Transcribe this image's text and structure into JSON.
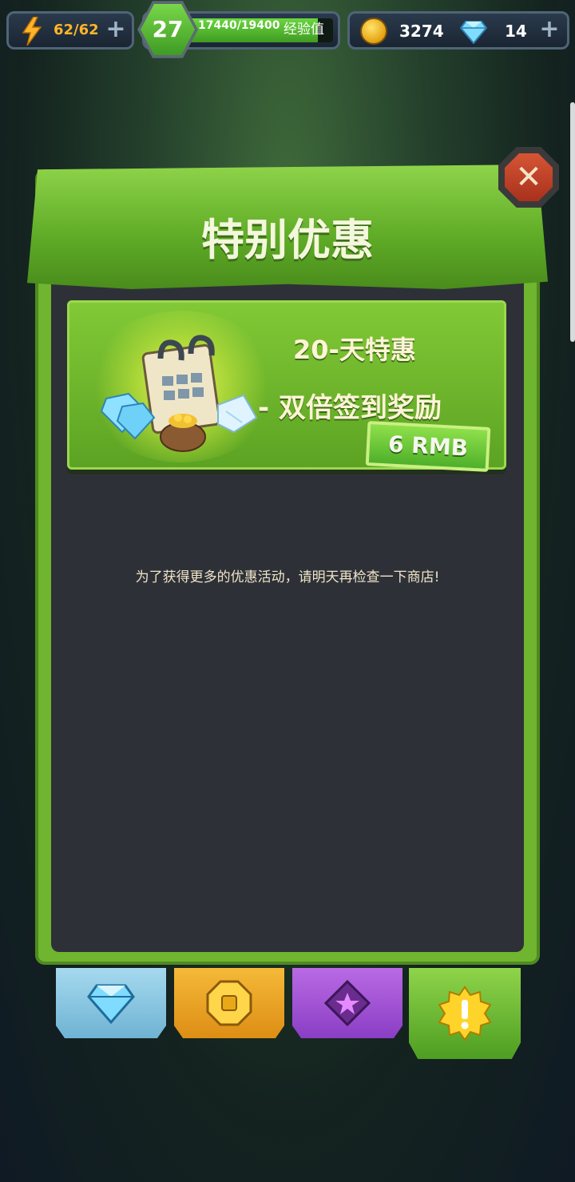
{
  "topbar": {
    "energy": "62/62",
    "level": "27",
    "xp_text": "17440/19400",
    "xp_label": "经验值",
    "xp_fraction": 0.899,
    "coins": "3274",
    "gems": "14"
  },
  "dialog": {
    "title": "特别优惠",
    "close_icon": "close-x-icon",
    "offer": {
      "title_line1": "20-天特惠",
      "title_line2": "- 双倍签到奖励",
      "price": "6 RMB"
    },
    "notice": "为了获得更多的优惠活动，请明天再检查一下商店!"
  },
  "tabs": [
    "gem-tab-icon",
    "coin-tab-icon",
    "star-tab-icon",
    "alert-tab-icon"
  ],
  "colors": {
    "accent_green": "#6fb52f",
    "close_red": "#c2432a",
    "panel_dark": "#2d3137"
  }
}
